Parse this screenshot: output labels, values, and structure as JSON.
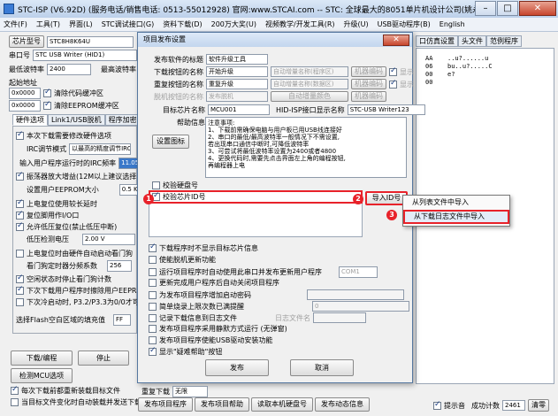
{
  "window": {
    "title": "STC-ISP (V6.92D) (服务电话/销售电话: 0513-55012928) 官网:www.STCAI.com -- STC: 全球最大的8051单片机设计公司(姚永平)",
    "buttons": {
      "minimize": "–",
      "maximize": "□",
      "close": "✕"
    }
  },
  "menu": [
    "文件(F)",
    "工具(T)",
    "界面(L)",
    "STC调试接口(G)",
    "资料下载(D)",
    "200万大奖(U)",
    "视频教学/开发工具(R)",
    "升级(U)",
    "USB驱动程序(B)",
    "English"
  ],
  "left": {
    "chip_label": "芯片型号",
    "chip_value": "STC8H8K64U",
    "pins_label": "引脚数",
    "pins_value": "Auto",
    "port_label": "串口号",
    "port_value": "STC USB Writer (HID1)",
    "scan_label": "扫描",
    "min_baud_label": "最低波特率",
    "min_baud_value": "2400",
    "max_baud_label": "最高波特率",
    "start_addr_label": "起始地址",
    "addr1": "0x0000",
    "clear_code_label": "清除代码缓冲区",
    "addr2": "0x0000",
    "clear_eeprom_label": "清除EEPROM缓冲区",
    "tabs": [
      "硬件选项",
      "Link1/USB脱机",
      "程序加密后传输"
    ],
    "options": [
      "本次下载需要修改硬件选项",
      "输入用户程序运行时的IRC频率",
      "振荡器放大增益(12M以上建议选择)",
      "设置用户EEPROM大小",
      "上电复位使用较长延时",
      "复位脚用作I/O口",
      "允许低压复位(禁止低压中断)",
      "低压检测电压",
      "上电复位时由硬件自动启动看门狗",
      "看门狗定时器分频系数",
      "空闲状态时停止看门狗计数",
      "下次下载用户程序时擦除用户EEPROM区",
      "下次冷启动时, P3.2/P3.3为0/0才可下载程序",
      "选择Flash空白区域的填充值"
    ],
    "irc_mode_label": "IRC调节模式",
    "irc_mode_value": "以最高的精度调节IRC频率",
    "irc_freq_value": "11.0592",
    "eeprom_size": "0.5 K",
    "lvd_value": "2.00 V",
    "wdt_div": "256",
    "fill_value": "FF",
    "download_btn": "下载/编程",
    "stop_btn": "停止",
    "check_mcu_btn": "检测MCU选项",
    "redownload_label": "重复",
    "reload_label": "每次下载前都重新装载目标文件",
    "auto_send_label": "当目标文件变化时自动装载并发送下载命令"
  },
  "right": {
    "tabs": [
      "口仿真设置",
      "头文件",
      "范例程序"
    ],
    "hex_lines": [
      "AA",
      "06",
      "00",
      "00"
    ],
    "ascii_lines": [
      "..u?......u",
      "bu..u?.....C",
      "e?"
    ]
  },
  "dialog": {
    "title": "项目发布设置",
    "close": "✕",
    "pub_title_label": "发布软件的标题",
    "pub_title_value": "软件升级工具",
    "dl_btn_label": "下载按钮的名称",
    "dl_btn_value": "开始升级",
    "auto_inc_label": "自动增量名称(程序区)",
    "machine_code_1": "机器编码",
    "show_label_1": "显示",
    "redl_btn_label": "重复按钮的名称",
    "redl_btn_value": "重复升级",
    "auto_inc_label2": "自动增量名称(数据区)",
    "machine_code_2": "机器编码",
    "show_label_2": "显示",
    "offline_btn_label": "脱机按钮的名称",
    "offline_btn_value": "发布脱机",
    "auto_inc_color": "自动增量颜色",
    "machine_code_3": "机器编码",
    "target_chip_label": "目标芯片名称",
    "target_chip_value": "MCU001",
    "hid_label": "HID-ISP接口显示名称",
    "hid_value": "STC-USB Writer123",
    "help_label": "帮助信息",
    "set_icon_btn": "设置图标",
    "notes": [
      "注意事项:",
      "1、下载前需确保电脑与用户板已用USB线连接好",
      "2、串口的最低/最高波特率一般情况下不需设置,",
      "   若出现串口通信中断时,可降低波特率",
      "3、可尝试将最低波特率设置为2400或者4800",
      "4、更换代码时,需要先点击界面左上角的编程按钮,",
      "   再编程器上电"
    ],
    "check_disk_label": "校验硬盘号",
    "check_id_label": "校验芯片ID号",
    "import_btn": "导入ID号",
    "checkbox_opts": [
      "下载程序时不显示目标芯片信息",
      "使能脱机更新功能",
      "运行项目程序时自动使用此串口并发布更新用户程序",
      "更新完成用户程序后自动关闭项目程序",
      "为发布项目程序增加启动密码",
      "简单烧录上限次数已满提醒",
      "记录下载信息到日志文件",
      "发布项目程序采用静默方式运行 (无弹窗)",
      "发布项目程序使能USB驱动安装功能",
      "显示\"疑难帮助\"按钮"
    ],
    "com_value": "COM1",
    "max_count_value": "0",
    "log_file_label": "日志文件名",
    "publish_btn": "发布",
    "cancel_btn": "取消"
  },
  "popup": {
    "items": [
      "从列表文件中导入",
      "从下载日志文件中导入"
    ]
  },
  "badges": [
    "1",
    "2",
    "3"
  ],
  "status": {
    "buttons": [
      "发布项目程序",
      "发布项目帮助",
      "读取本机硬盘号",
      "发布动态信息"
    ],
    "beep_label": "提示音",
    "success_label": "成功计数",
    "success_value": "2461",
    "clear_btn": "清零",
    "dl_redownload_label": "重复下载",
    "none_value": "无限"
  }
}
